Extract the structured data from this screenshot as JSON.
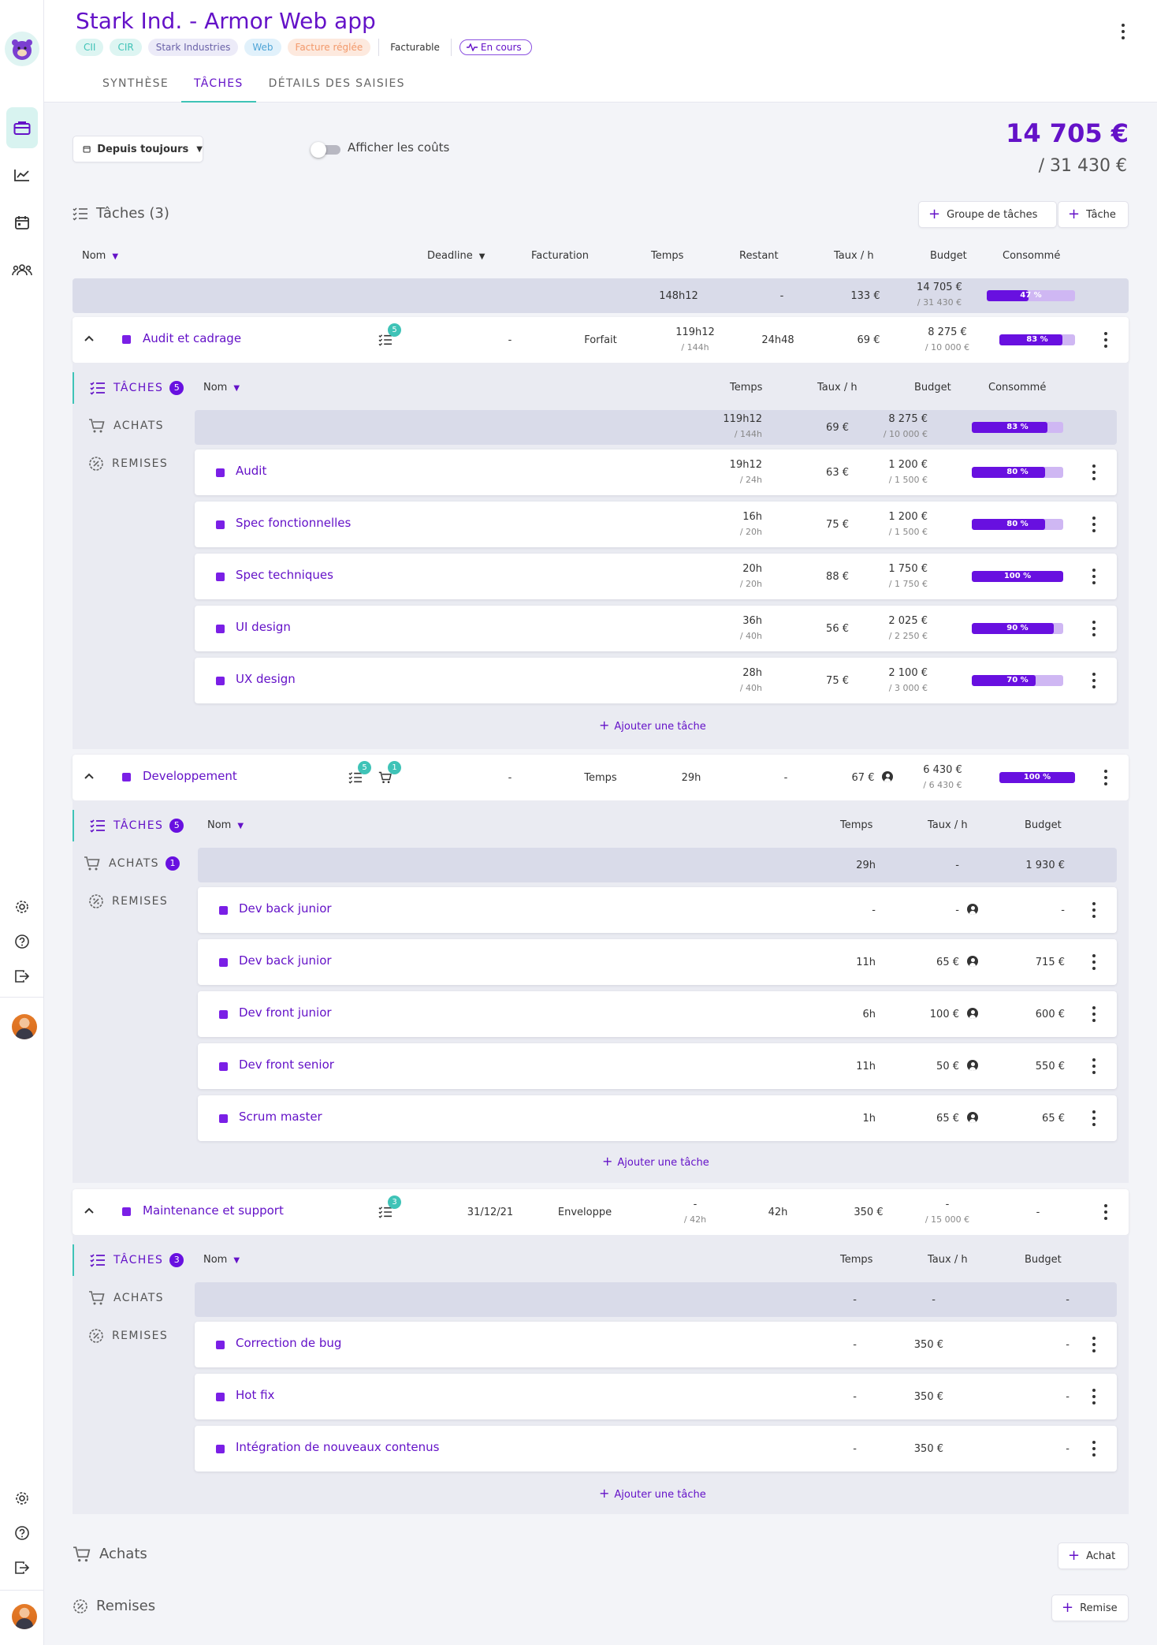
{
  "project": {
    "title": "Stark Ind. - Armor Web app",
    "tags": [
      {
        "label": "CII",
        "color": "#3fc3b7",
        "bg": "#ddf5f2"
      },
      {
        "label": "CIR",
        "color": "#3fc3b7",
        "bg": "#ddf5f2"
      },
      {
        "label": "Stark Industries",
        "color": "#6a62a8",
        "bg": "#ecebf8"
      },
      {
        "label": "Web",
        "color": "#4ea4d6",
        "bg": "#e1f1fb"
      },
      {
        "label": "Facture réglée",
        "color": "#f2996b",
        "bg": "#fde9de"
      }
    ],
    "billable": "Facturable",
    "status": "En cours"
  },
  "tabs": [
    "SYNTHÈSE",
    "TÂCHES",
    "DÉTAILS DES SAISIES"
  ],
  "filters": {
    "period": "Depuis toujours",
    "show_costs": "Afficher les coûts"
  },
  "totals": {
    "consumed": "14 705 €",
    "budget": "/ 31 430 €"
  },
  "tasks_section": {
    "title": "Tâches (3)",
    "add_group": "Groupe de tâches",
    "add_task": "Tâche"
  },
  "columns": {
    "name": "Nom",
    "deadline": "Deadline",
    "billing": "Facturation",
    "time": "Temps",
    "remaining": "Restant",
    "rate": "Taux / h",
    "budget": "Budget",
    "consumed": "Consommé"
  },
  "summary": {
    "time": "148h12",
    "remaining": "-",
    "rate": "133 €",
    "budget": "14 705 €",
    "budget_total": "/ 31 430 €",
    "consumed_pct": 47,
    "consumed_label": "47 %"
  },
  "subtabs": {
    "tasks": "TÂCHES",
    "purchases": "ACHATS",
    "discounts": "REMISES"
  },
  "add_task_label": "Ajouter une tâche",
  "groups": [
    {
      "name": "Audit et cadrage",
      "task_count": "5",
      "purchase_count": "",
      "deadline": "-",
      "billing": "Forfait",
      "time": "119h12",
      "time_total": "/ 144h",
      "remaining": "24h48",
      "rate": "69 €",
      "budget": "8 275 €",
      "budget_total": "/ 10 000 €",
      "consumed_pct": 83,
      "consumed_label": "83 %",
      "sub": {
        "time": "119h12",
        "time_total": "/ 144h",
        "rate": "69 €",
        "budget": "8 275 €",
        "budget_total": "/ 10 000 €",
        "consumed_pct": 83,
        "consumed_label": "83 %"
      },
      "tasks": [
        {
          "name": "Audit",
          "time": "19h12",
          "time_total": "/ 24h",
          "rate": "63 €",
          "budget": "1 200 €",
          "budget_total": "/ 1 500 €",
          "pct": 80,
          "label": "80 %"
        },
        {
          "name": "Spec fonctionnelles",
          "time": "16h",
          "time_total": "/ 20h",
          "rate": "75 €",
          "budget": "1 200 €",
          "budget_total": "/ 1 500 €",
          "pct": 80,
          "label": "80 %"
        },
        {
          "name": "Spec techniques",
          "time": "20h",
          "time_total": "/ 20h",
          "rate": "88 €",
          "budget": "1 750 €",
          "budget_total": "/ 1 750 €",
          "pct": 100,
          "label": "100 %"
        },
        {
          "name": "UI design",
          "time": "36h",
          "time_total": "/ 40h",
          "rate": "56 €",
          "budget": "2 025 €",
          "budget_total": "/ 2 250 €",
          "pct": 90,
          "label": "90 %"
        },
        {
          "name": "UX design",
          "time": "28h",
          "time_total": "/ 40h",
          "rate": "75 €",
          "budget": "2 100 €",
          "budget_total": "/ 3 000 €",
          "pct": 70,
          "label": "70 %"
        }
      ]
    },
    {
      "name": "Developpement",
      "task_count": "5",
      "purchase_count": "1",
      "deadline": "-",
      "billing": "Temps",
      "time": "29h",
      "remaining": "-",
      "rate": "67 €",
      "budget": "6 430 €",
      "budget_total": "/ 6 430 €",
      "consumed_pct": 100,
      "consumed_label": "100 %",
      "sub": {
        "time": "29h",
        "rate": "-",
        "budget": "1 930 €"
      },
      "tasks": [
        {
          "name": "Dev back junior",
          "time": "-",
          "rate": "-",
          "budget": "-"
        },
        {
          "name": "Dev back junior",
          "time": "11h",
          "rate": "65 €",
          "budget": "715 €"
        },
        {
          "name": "Dev front junior",
          "time": "6h",
          "rate": "100 €",
          "budget": "600 €"
        },
        {
          "name": "Dev front senior",
          "time": "11h",
          "rate": "50 €",
          "budget": "550 €"
        },
        {
          "name": "Scrum master",
          "time": "1h",
          "rate": "65 €",
          "budget": "65 €"
        }
      ]
    },
    {
      "name": "Maintenance et support",
      "task_count": "3",
      "purchase_count": "",
      "deadline": "31/12/21",
      "billing": "Enveloppe",
      "time": "-",
      "time_total": "/ 42h",
      "remaining": "42h",
      "rate": "350 €",
      "budget": "-",
      "budget_total": "/ 15 000 €",
      "consumed": "-",
      "sub": {
        "time": "-",
        "rate": "-",
        "budget": "-"
      },
      "tasks": [
        {
          "name": "Correction de bug",
          "time": "-",
          "rate": "350 €",
          "budget": "-"
        },
        {
          "name": "Hot fix",
          "time": "-",
          "rate": "350 €",
          "budget": "-"
        },
        {
          "name": "Intégration de nouveaux contenus",
          "time": "-",
          "rate": "350 €",
          "budget": "-"
        }
      ]
    }
  ],
  "purchases": {
    "title": "Achats",
    "add": "Achat"
  },
  "discounts": {
    "title": "Remises",
    "add": "Remise"
  },
  "icons": [
    "briefcase-icon",
    "chart-line-icon",
    "calendar-icon",
    "team-icon",
    "gear-icon",
    "help-icon",
    "logout-icon",
    "checklist-icon",
    "cart-icon",
    "discount-icon",
    "user-icon",
    "chevron-up-icon",
    "kebab-icon",
    "pulse-icon"
  ]
}
